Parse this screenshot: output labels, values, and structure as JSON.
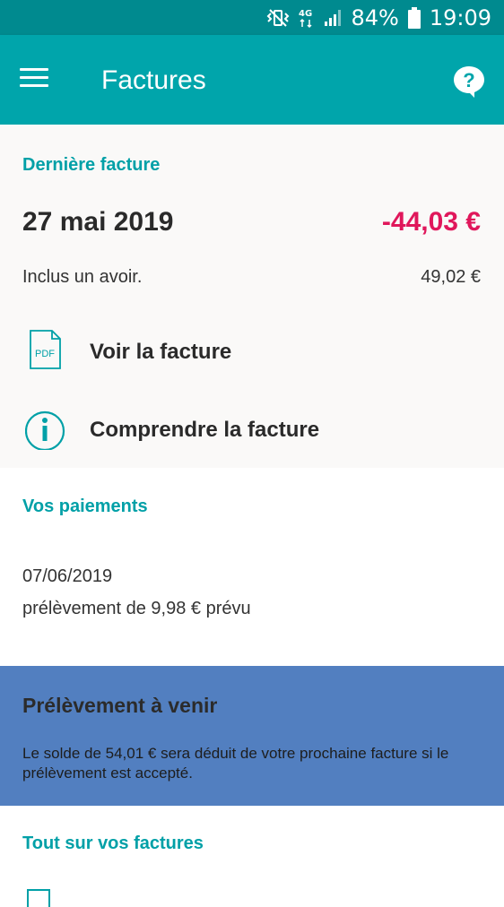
{
  "status_bar": {
    "battery": "84%",
    "time": "19:09",
    "network": "4G",
    "icons": [
      "vibrate-icon",
      "network-4g-icon",
      "signal-icon",
      "battery-icon"
    ]
  },
  "app_bar": {
    "title": "Factures",
    "menu_icon": "hamburger-menu-icon",
    "help_icon": "help-bubble-icon"
  },
  "last_invoice": {
    "section_title": "Dernière facture",
    "date": "27 mai 2019",
    "amount": "-44,03 €",
    "credit_label": "Inclus un avoir.",
    "credit_value": "49,02 €",
    "actions": [
      {
        "label": "Voir la facture",
        "icon": "pdf-file-icon",
        "icon_text": "PDF"
      },
      {
        "label": "Comprendre la facture",
        "icon": "info-icon"
      }
    ]
  },
  "payments": {
    "section_title": "Vos paiements",
    "date": "07/06/2019",
    "description": "prélèvement de 9,98 € prévu"
  },
  "upcoming_debit": {
    "title": "Prélèvement à venir",
    "text": "Le solde de 54,01 € sera déduit de votre prochaine facture si le prélèvement est accepté."
  },
  "all_invoices": {
    "section_title": "Tout sur vos factures"
  },
  "colors": {
    "status_bar": "#008a8f",
    "app_bar": "#00a5ab",
    "accent": "#00a0a7",
    "amount_negative": "#e0175b",
    "banner": "#527fc0"
  }
}
